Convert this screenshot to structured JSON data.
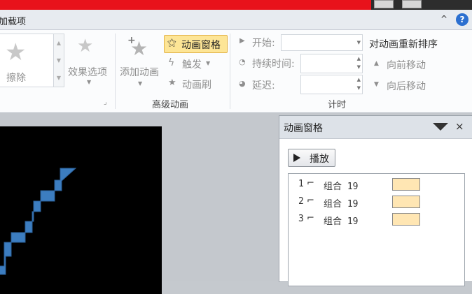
{
  "ribbon_tab": "加载项",
  "colors": {
    "title_bar": "#e8121b",
    "highlight": "#fde596",
    "timing_bar": "#ffe6b3"
  },
  "ribbon": {
    "remove_label": "擦除",
    "effect_options_label": "效果选项",
    "add_animation_label": "添加动画",
    "animation_pane_label": "动画窗格",
    "trigger_label": "触发",
    "animation_painter_label": "动画刷",
    "advanced_group_label": "高级动画",
    "start_label": "开始:",
    "start_value": "",
    "duration_label": "持续时间:",
    "duration_value": "",
    "delay_label": "延迟:",
    "delay_value": "",
    "timing_group_label": "计时",
    "reorder_title": "对动画重新排序",
    "move_earlier_label": "向前移动",
    "move_later_label": "向后移动"
  },
  "pane": {
    "title": "动画窗格",
    "play_label": "播放",
    "items": [
      {
        "num": "1",
        "name": "组合 19"
      },
      {
        "num": "2",
        "name": "组合 19"
      },
      {
        "num": "3",
        "name": "组合 19"
      }
    ]
  }
}
